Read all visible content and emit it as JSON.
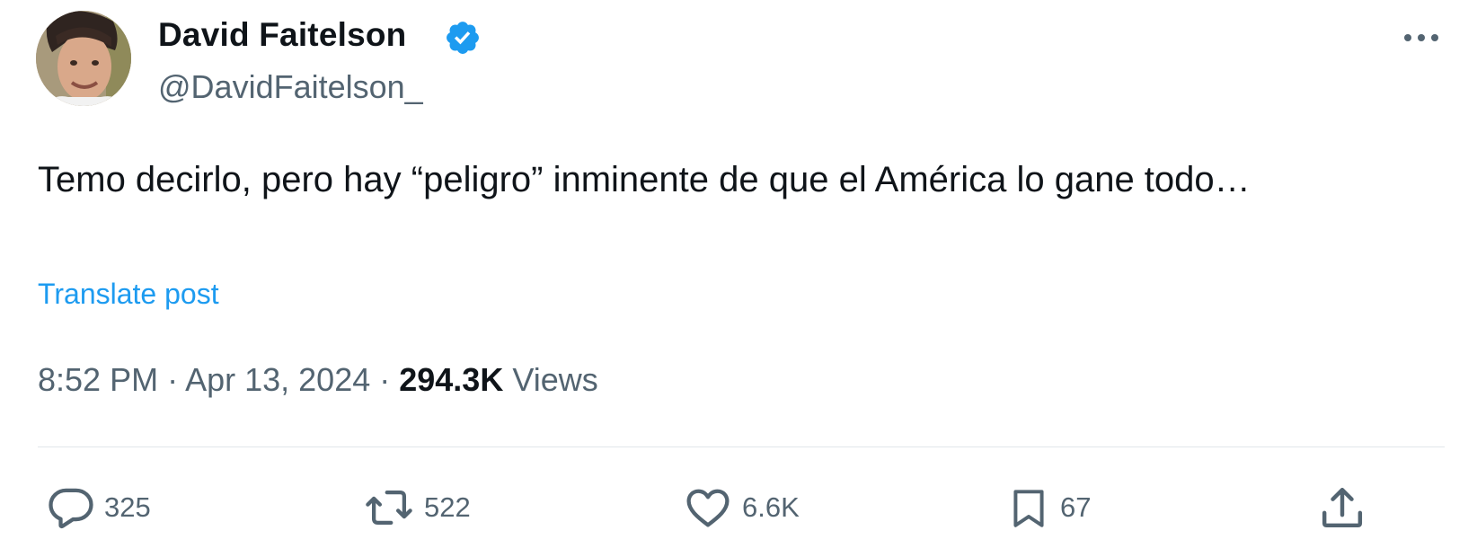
{
  "author": {
    "name": "David Faitelson",
    "handle": "@DavidFaitelson_",
    "verified": true
  },
  "tweet": {
    "text": "Temo decirlo, pero hay “peligro” inminente de que el América lo gane todo…",
    "translate_label": "Translate post"
  },
  "meta": {
    "timestamp": "8:52 PM · Apr 13, 2024 · ",
    "views_count": "294.3K",
    "views_label": " Views"
  },
  "actions": {
    "replies": "325",
    "reposts": "522",
    "likes": "6.6K",
    "bookmarks": "67"
  },
  "icons": {
    "verified": "verified-badge-icon",
    "more": "more-options-icon",
    "reply": "reply-icon",
    "repost": "repost-icon",
    "like": "heart-icon",
    "bookmark": "bookmark-icon",
    "share": "share-icon"
  },
  "colors": {
    "primary_text": "#0f1419",
    "secondary_text": "#536471",
    "accent": "#1d9bf0"
  }
}
